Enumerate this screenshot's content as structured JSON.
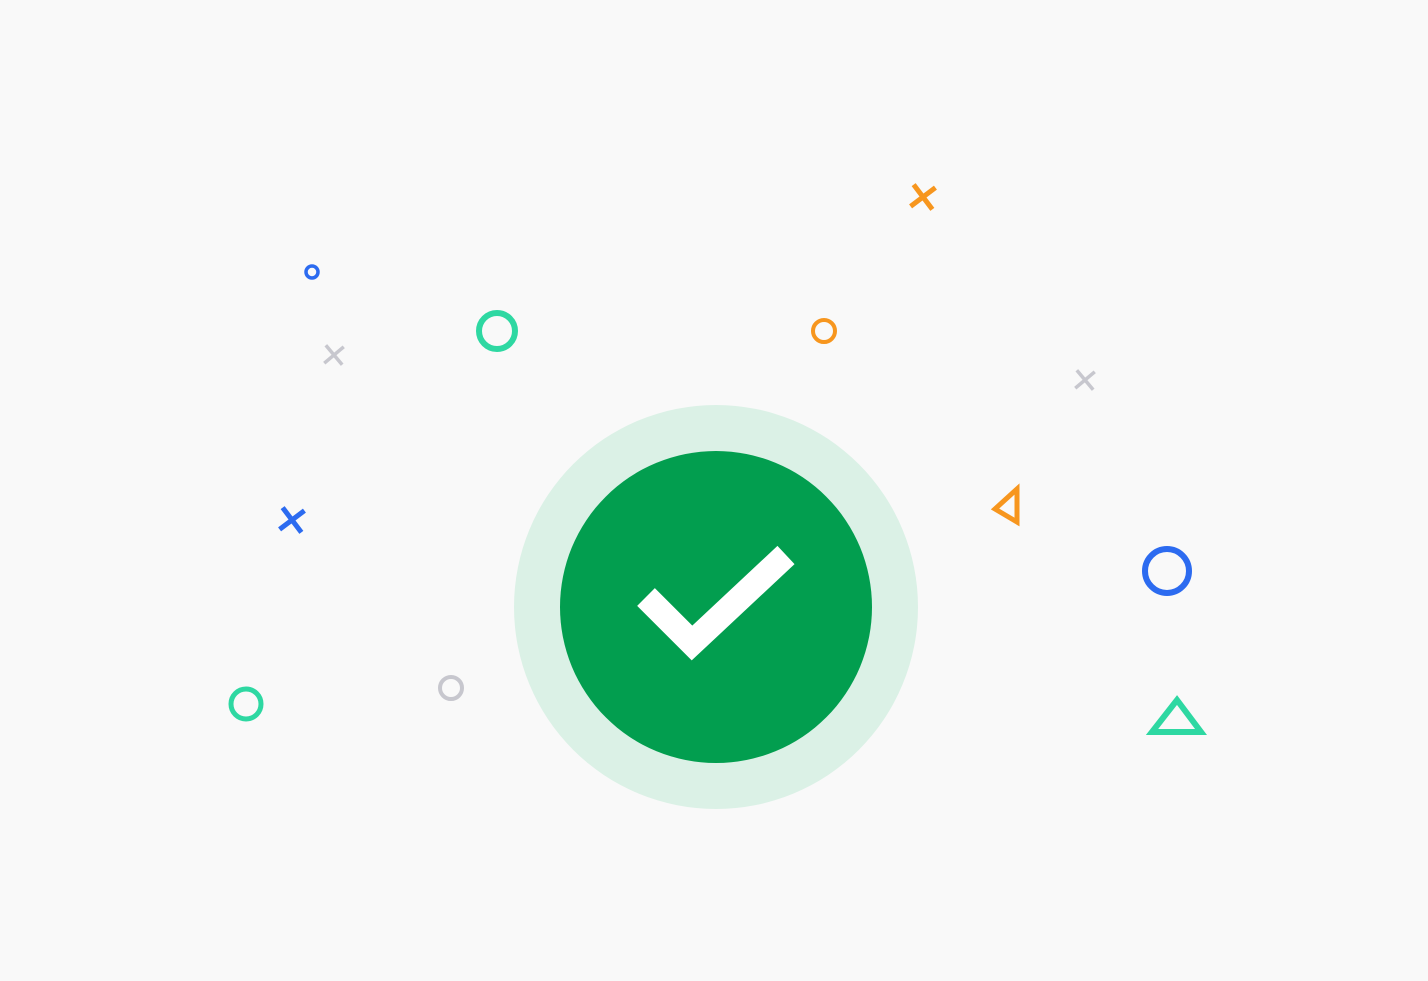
{
  "page": {
    "background": "#f9f9f9"
  },
  "success_badge": {
    "icon": "check-icon",
    "halo_color": "#dbf1e6",
    "circle_color": "#029e4f",
    "check_color": "#ffffff"
  },
  "confetti": {
    "palette": {
      "blue": "#2c6bf0",
      "green": "#2ed8a2",
      "orange": "#f7961e",
      "gray": "#c7c7ce"
    },
    "shapes": [
      {
        "name": "confetti-circle-icon",
        "shape": "circle",
        "color": "blue"
      },
      {
        "name": "confetti-cross-icon",
        "shape": "cross",
        "color": "gray"
      },
      {
        "name": "confetti-circle-icon",
        "shape": "circle",
        "color": "green"
      },
      {
        "name": "confetti-cross-icon",
        "shape": "cross",
        "color": "blue"
      },
      {
        "name": "confetti-circle-icon",
        "shape": "circle",
        "color": "green"
      },
      {
        "name": "confetti-circle-icon",
        "shape": "circle",
        "color": "gray"
      },
      {
        "name": "confetti-cross-icon",
        "shape": "cross",
        "color": "orange"
      },
      {
        "name": "confetti-circle-icon",
        "shape": "circle",
        "color": "orange"
      },
      {
        "name": "confetti-cross-icon",
        "shape": "cross",
        "color": "gray"
      },
      {
        "name": "confetti-triangle-icon",
        "shape": "triangle",
        "color": "orange"
      },
      {
        "name": "confetti-circle-icon",
        "shape": "circle",
        "color": "blue"
      },
      {
        "name": "confetti-triangle-icon",
        "shape": "triangle",
        "color": "green"
      }
    ]
  }
}
